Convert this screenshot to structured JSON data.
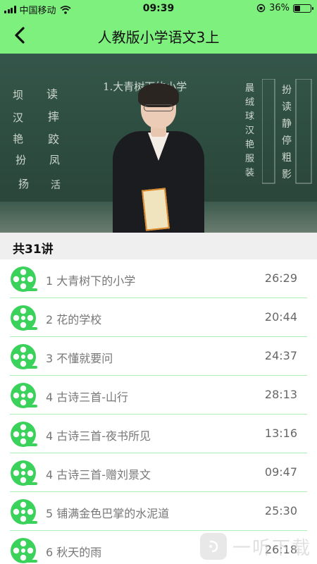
{
  "status_bar": {
    "carrier": "中国移动",
    "time": "09:39",
    "battery_text": "36%",
    "battery_level": 0.36
  },
  "header": {
    "title": "人教版小学语文3上",
    "back_icon": "chevron-left-icon"
  },
  "video": {
    "board_left_chars": [
      "坝",
      "读",
      "汉",
      "摔",
      "艳",
      "跤",
      "扮",
      "凤",
      "扬",
      "活"
    ],
    "board_title": "1.大青树下的小学",
    "board_right_cols": [
      "晨绒球汉艳服装",
      "扮读静停粗影"
    ]
  },
  "count_label": "共31讲",
  "lesson_icon": "film-reel-icon",
  "lessons": [
    {
      "title": "1 大青树下的小学",
      "duration": "26:29"
    },
    {
      "title": "2 花的学校",
      "duration": "20:44"
    },
    {
      "title": "3 不懂就要问",
      "duration": "24:37"
    },
    {
      "title": "4 古诗三首-山行",
      "duration": "28:13"
    },
    {
      "title": "4 古诗三首-夜书所见",
      "duration": "13:16"
    },
    {
      "title": "4 古诗三首-赠刘景文",
      "duration": "09:47"
    },
    {
      "title": "5 铺满金色巴掌的水泥道",
      "duration": "25:30"
    },
    {
      "title": "6 秋天的雨",
      "duration": "26:18"
    }
  ],
  "watermark": {
    "text": "一听下载"
  },
  "colors": {
    "accent_green": "#7ef07e",
    "icon_green": "#3ad25a",
    "divider": "#a9f0b9"
  }
}
